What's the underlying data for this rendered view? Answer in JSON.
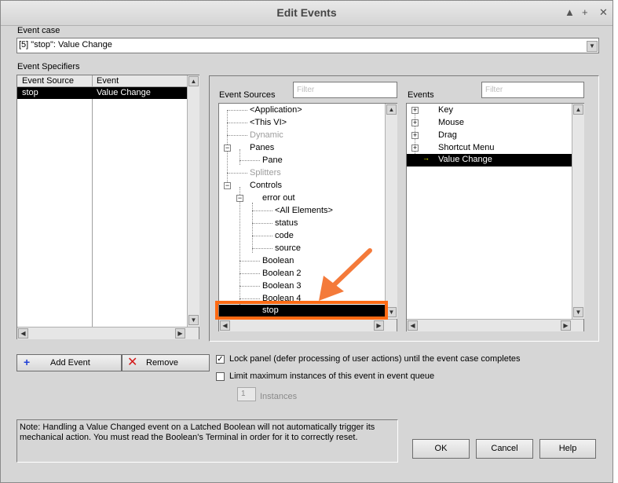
{
  "window": {
    "title": "Edit Events",
    "controls": [
      "▲",
      "+",
      "✕"
    ]
  },
  "event_case": {
    "label": "Event case",
    "value": "[5] \"stop\": Value Change"
  },
  "event_specifiers": {
    "label": "Event Specifiers",
    "columns": [
      "Event Source",
      "Event"
    ],
    "rows": [
      {
        "source": "stop",
        "event": "Value Change"
      }
    ]
  },
  "event_sources": {
    "label": "Event Sources",
    "filter_placeholder": "Filter",
    "items": [
      {
        "label": "<Application>",
        "state": "normal"
      },
      {
        "label": "<This VI>",
        "state": "normal"
      },
      {
        "label": "Dynamic",
        "state": "disabled"
      },
      {
        "label": "Panes",
        "state": "normal"
      },
      {
        "label": "Pane",
        "state": "normal"
      },
      {
        "label": "Splitters",
        "state": "disabled"
      },
      {
        "label": "Controls",
        "state": "normal"
      },
      {
        "label": "error out",
        "state": "normal"
      },
      {
        "label": "<All Elements>",
        "state": "normal"
      },
      {
        "label": "status",
        "state": "normal"
      },
      {
        "label": "code",
        "state": "normal"
      },
      {
        "label": "source",
        "state": "normal"
      },
      {
        "label": "Boolean",
        "state": "normal"
      },
      {
        "label": "Boolean 2",
        "state": "normal"
      },
      {
        "label": "Boolean 3",
        "state": "normal"
      },
      {
        "label": "Boolean 4",
        "state": "normal"
      },
      {
        "label": "stop",
        "state": "selected"
      }
    ]
  },
  "events": {
    "label": "Events",
    "filter_placeholder": "Filter",
    "items": [
      {
        "label": "Key",
        "state": "normal"
      },
      {
        "label": "Mouse",
        "state": "normal"
      },
      {
        "label": "Drag",
        "state": "normal"
      },
      {
        "label": "Shortcut Menu",
        "state": "normal"
      },
      {
        "label": "Value Change",
        "state": "selected"
      }
    ]
  },
  "buttons": {
    "add_event": "Add Event",
    "remove": "Remove",
    "ok": "OK",
    "cancel": "Cancel",
    "help": "Help"
  },
  "options": {
    "lock_panel": {
      "label": "Lock panel (defer processing of user actions) until the event case completes",
      "checked": true
    },
    "limit_instances": {
      "label": "Limit maximum instances of this event in event queue",
      "checked": false
    },
    "instances_value": "1",
    "instances_label": "Instances"
  },
  "note": "Note:  Handling a Value Changed event on a Latched Boolean will not automatically trigger its mechanical action. You must read the Boolean's Terminal in order for it to correctly reset.",
  "colors": {
    "highlight_box": "#ff6a13",
    "annotation_arrow": "#f47a3a",
    "selection_bg": "#000000"
  }
}
